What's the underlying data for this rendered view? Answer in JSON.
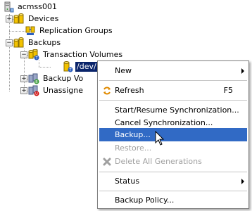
{
  "tree": {
    "root": {
      "label": "acmss001",
      "icon": "server-icon"
    },
    "items": [
      {
        "label": "Devices",
        "icon": "cylinders-icon"
      },
      {
        "label": "Replication Groups",
        "icon": "replication-icon"
      },
      {
        "label": "Backups",
        "icon": "cylinders-icon"
      },
      {
        "label": "Transaction Volumes",
        "icon": "transaction-volumes-icon"
      },
      {
        "label": "/dev/",
        "icon": "volume-icon"
      },
      {
        "label": "Backup Vo",
        "icon": "backup-volumes-icon"
      },
      {
        "label": "Unassigne",
        "icon": "unassigned-icon"
      }
    ]
  },
  "context_menu": {
    "items": [
      {
        "label": "New",
        "submenu": true
      },
      {
        "label": "Refresh",
        "shortcut": "F5",
        "icon": "refresh-icon"
      },
      {
        "label": "Start/Resume Synchronization..."
      },
      {
        "label": "Cancel Synchronization..."
      },
      {
        "label": "Backup...",
        "highlighted": true
      },
      {
        "label": "Restore...",
        "disabled": true
      },
      {
        "label": "Delete All Generations",
        "disabled": true,
        "icon": "delete-x-icon"
      },
      {
        "label": "Status",
        "submenu": true
      },
      {
        "label": "Backup Policy..."
      }
    ]
  },
  "colors": {
    "selection": "#0a246a",
    "menu_highlight": "#316ac5",
    "disabled_text": "#a0a0a0",
    "cylinder_yellow": "#f2c200",
    "badge_blue": "#2d5fbf",
    "badge_red": "#d01010"
  }
}
